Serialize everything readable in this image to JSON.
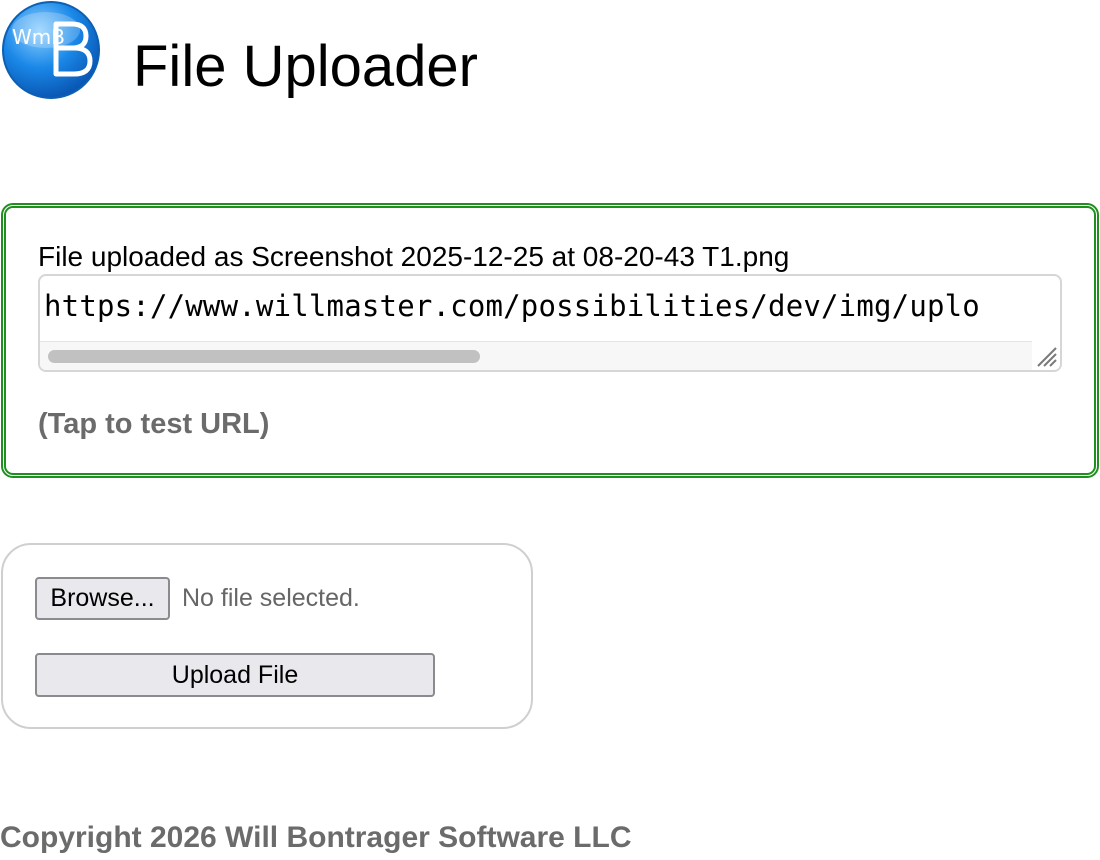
{
  "header": {
    "logo_text": "WmB",
    "title": "File Uploader"
  },
  "result": {
    "message": "File uploaded as Screenshot 2025-12-25 at 08-20-43 T1.png",
    "url": "https://www.willmaster.com/possibilities/dev/img/uplo",
    "tap_label": "(Tap to test URL)"
  },
  "upload_form": {
    "browse_label": "Browse...",
    "file_status": "No file selected.",
    "upload_label": "Upload File"
  },
  "footer": {
    "copyright": "Copyright 2026 Will Bontrager Software LLC"
  },
  "colors": {
    "success_border": "#1f8f1f",
    "muted_text": "#6b6b6b",
    "logo_blue": "#1a88e8"
  }
}
